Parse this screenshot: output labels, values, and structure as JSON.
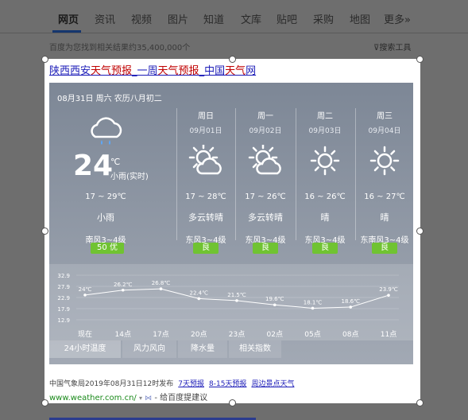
{
  "nav": {
    "items": [
      "网页",
      "资讯",
      "视频",
      "图片",
      "知道",
      "文库",
      "贴吧",
      "采购",
      "地图",
      "更多»"
    ],
    "result_count": "百度为您找到相关结果约35,400,000个",
    "tools": "搜索工具"
  },
  "result": {
    "title_parts": [
      {
        "text": "陕西西安",
        "hl": false
      },
      {
        "text": "天气预报",
        "hl": true
      },
      {
        "text": "_一周",
        "hl": false
      },
      {
        "text": "天气预报",
        "hl": true
      },
      {
        "text": "_中国",
        "hl": false
      },
      {
        "text": "天气",
        "hl": true
      },
      {
        "text": "网",
        "hl": false
      }
    ],
    "date_line": "08月31日 周六 农历八月初二",
    "today": {
      "temp": "24",
      "unit": "℃",
      "desc": "小雨(实时)",
      "range": "17 ~ 29℃",
      "cond": "小雨",
      "wind": "南风3~4级",
      "aqi": "50 优",
      "icon": "cloud-rain-icon"
    },
    "forecast": [
      {
        "day": "周日",
        "date": "09月01日",
        "range": "17 ~ 28℃",
        "cond": "多云转晴",
        "wind": "东风3~4级",
        "aqi": "良",
        "icon": "partly-cloudy-icon"
      },
      {
        "day": "周一",
        "date": "09月02日",
        "range": "17 ~ 26℃",
        "cond": "多云转晴",
        "wind": "东风3~4级",
        "aqi": "良",
        "icon": "partly-cloudy-icon"
      },
      {
        "day": "周二",
        "date": "09月03日",
        "range": "16 ~ 26℃",
        "cond": "晴",
        "wind": "东风3~4级",
        "aqi": "良",
        "icon": "sun-icon"
      },
      {
        "day": "周三",
        "date": "09月04日",
        "range": "16 ~ 27℃",
        "cond": "晴",
        "wind": "东南风3~4级",
        "aqi": "良",
        "icon": "sun-icon"
      }
    ],
    "tabs": [
      "24小时温度",
      "风力风向",
      "降水量",
      "相关指数"
    ],
    "source": "中国气象局2019年08月31日12时发布",
    "links": [
      "7天预报",
      "8-15天预报",
      "周边景点天气"
    ],
    "url": "www.weather.com.cn/",
    "feedback": "- 给百度提建议"
  },
  "chart_data": {
    "type": "line",
    "title": "",
    "x": [
      "现在",
      "14点",
      "17点",
      "20点",
      "23点",
      "02点",
      "05点",
      "08点",
      "11点"
    ],
    "series": [
      {
        "values": [
          24,
          26.2,
          26.8,
          22.4,
          21.5,
          19.6,
          18.1,
          18.6,
          23.9
        ]
      }
    ],
    "point_labels": [
      "24℃",
      "26.2℃",
      "26.8℃",
      "22.4℃",
      "21.5℃",
      "19.6℃",
      "18.1℃",
      "18.6℃",
      "23.9℃"
    ],
    "yticks": [
      "32.9",
      "27.9",
      "22.9",
      "17.9",
      "12.9"
    ],
    "ylim": [
      12.9,
      32.9
    ],
    "grid": true
  },
  "colors": {
    "aqi_green": "#70c332",
    "link": "#1c1cb8",
    "highlight": "#c00000",
    "url_green": "#1a8a1a"
  }
}
